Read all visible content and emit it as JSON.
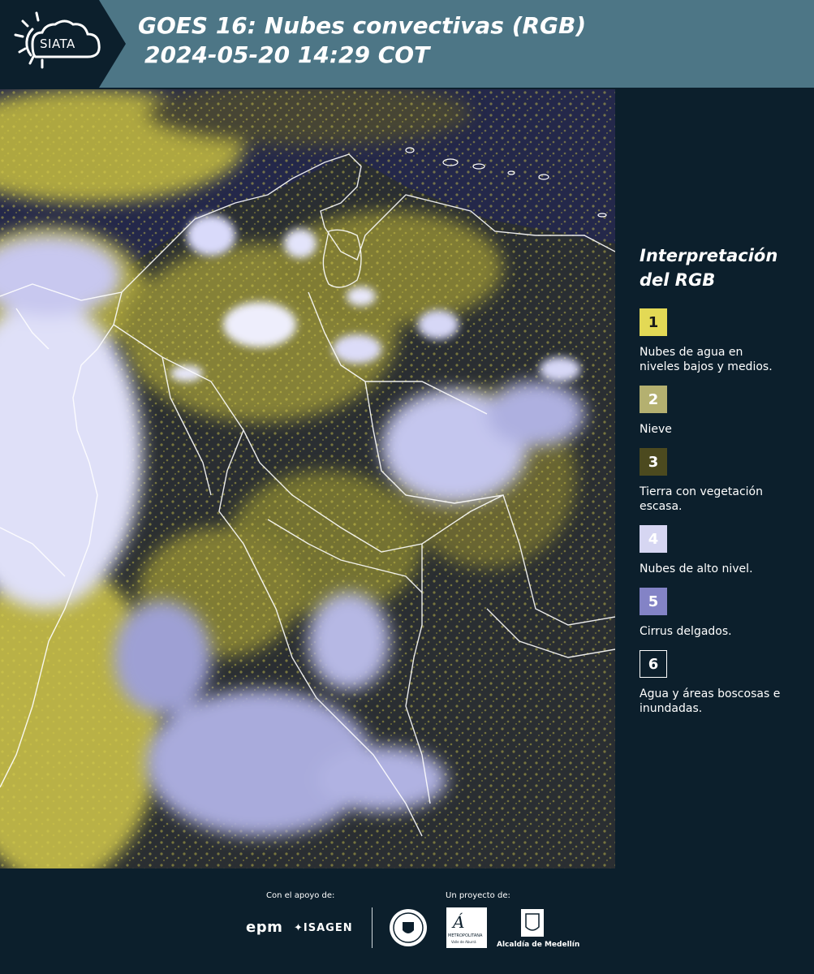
{
  "header": {
    "logo_text": "SIATA",
    "title_line1": "GOES 16: Nubes convectivas (RGB)",
    "title_line2": "2024-05-20 14:29 COT"
  },
  "legend": {
    "title_line1": "Interpretación",
    "title_line2": "del RGB",
    "items": [
      {
        "number": "1",
        "label": "Nubes de agua en niveles bajos y medios.",
        "color": "#e3d955",
        "text_color": "#1a1a1a"
      },
      {
        "number": "2",
        "label": "Nieve",
        "color": "#b4b070",
        "text_color": "#ffffff"
      },
      {
        "number": "3",
        "label": "Tierra con vegetación escasa.",
        "color": "#4c4a1f",
        "text_color": "#ffffff"
      },
      {
        "number": "4",
        "label": "Nubes de alto nivel.",
        "color": "#d6d6f2",
        "text_color": "#ffffff"
      },
      {
        "number": "5",
        "label": "Cirrus delgados.",
        "color": "#8383c6",
        "text_color": "#ffffff"
      },
      {
        "number": "6",
        "label": "Agua y áreas boscosas e inundadas.",
        "color": "#0c1f2c",
        "text_color": "#ffffff"
      }
    ]
  },
  "footer": {
    "support_caption": "Con el apoyo de:",
    "project_caption": "Un proyecto de:",
    "sponsors": {
      "epm": "epm",
      "isagen": "ISAGEN",
      "area_line1": "METROPOLITANA",
      "area_line2": "Valle de Aburrá",
      "alcaldia": "Alcaldía de Medellín"
    }
  },
  "colors": {
    "header_bg": "#4d7686",
    "page_bg": "#0c1f2c",
    "map_bg": "#23284a",
    "low_cloud_yellow": "#e3d955",
    "high_cloud_lavender": "#d6d6f2"
  }
}
